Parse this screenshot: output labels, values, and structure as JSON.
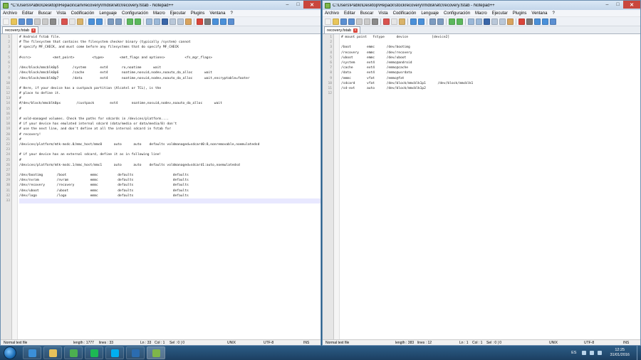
{
  "colors": {
    "close_button": "#c9463d",
    "current_line": "#e8e8ff",
    "taskbar": "#1c3f61"
  },
  "menu_items": [
    "Archivo",
    "Editar",
    "Buscar",
    "Vista",
    "Codificación",
    "Lenguaje",
    "Configuración",
    "Macro",
    "Ejecutar",
    "Plugins",
    "Ventana",
    "?"
  ],
  "left": {
    "title": "*C:\\Users\\Pablo\\Desktop\\Repack\\carlvrecovery\\rmdisk\\etc\\recovery.fstab - Notepad++",
    "tab": "recovery.fstab",
    "lines": [
      "# Android fstab file.",
      "# The filesystem that contains the filesystem checker binary (typically /system) cannot",
      "# specify MF_CHECK, and must come before any filesystems that do specify MF_CHECK",
      "",
      "#<src>           <mnt_point>         <type>        <mnt_flags and options>          <fs_mgr_flags>",
      "",
      "/dev/block/mmcblk0p5       /system       ext4       ro,noatime      wait",
      "/dev/block/mmcblk0p6       /cache        ext4       noatime,nosuid,nodev,noauto_da_alloc      wait",
      "/dev/block/mmcblk0p7       /data         ext4       noatime,nosuid,nodev,noauto_da_alloc      wait,encryptable=footer",
      "",
      "# Here, if your device has a custpack partition (Alcatel or TCL), is the",
      "# place to define it.",
      "#",
      "#/dev/block/mmcblk0px        /custpack        ext4       noatime,nosuid,nodev,noauto_da_alloc      wait",
      "#",
      "",
      "# vold-managed volumes. Check the paths for sdcards in /devices/platform....",
      "# if your device has emulated internal sdcard (data/media or data/media/0) don't",
      "# use the next line, and don't define at all the internal sdcard in fstab for",
      "# recovery!",
      "#",
      "/devices/platform/mtk-msdc.0/mmc_host/mmc0      auto      auto    defaults voldmanaged=sdcard0:8,nonremovable,noemulatedsd",
      "",
      "# if your device has an external sdcard, define it as in following line!",
      "#",
      "/devices/platform/mtk-msdc.1/mmc_host/mmc1      auto      auto    defaults voldmanaged=sdcard1:auto,noemulatedsd",
      "",
      "/dev/bootimg       /boot            emmc          defaults                    defaults",
      "/dev/nvram         /nvram           emmc          defaults                    defaults",
      "/dev/recovery      /recovery        emmc          defaults                    defaults",
      "/dev/uboot         /uboot           emmc          defaults                    defaults",
      "/dev/logo          /logo            emmc          defaults                    defaults",
      ""
    ],
    "status": {
      "type": "Normal text file",
      "length": "length : 1777",
      "lines": "lines : 33",
      "ln": "Ln : 33",
      "col": "Col : 1",
      "sel": "Sel : 0 | 0",
      "eol": "UNIX",
      "encoding": "UTF-8",
      "mode": "INS"
    }
  },
  "right": {
    "title": "C:\\Users\\Pablo\\Desktop\\Repack\\stockrecovery\\rmdisk\\etc\\recovery.fstab - Notepad++",
    "tab": "recovery.fstab",
    "lines": [
      "# mount point   fstype      device            [device2]",
      "",
      "/boot        emmc      /dev/bootimg",
      "/recovery    emmc      /dev/recovery",
      "/uboot       emmc      /dev/uboot",
      "/system      ext4      /emmc@android",
      "/cache       ext4      /emmc@cache",
      "/data        ext4      /emmc@usrdata",
      "/emmc        vfat      /emmc@fat",
      "/sdcard      vfat      /dev/block/mmcblk1p1      /dev/block/mmcblk1",
      "/sd-ext      auto      /dev/block/mmcblk1p2",
      ""
    ],
    "status": {
      "type": "Normal text file",
      "length": "length : 383",
      "lines": "lines : 12",
      "ln": "Ln : 1",
      "col": "Col : 1",
      "sel": "Sel : 0 | 0",
      "eol": "UNIX",
      "encoding": "UTF-8",
      "mode": "INS"
    }
  },
  "taskbar": {
    "apps": [
      {
        "name": "ie",
        "color": "#3b8fd8"
      },
      {
        "name": "explorer",
        "color": "#e7c15a"
      },
      {
        "name": "chrome",
        "color": "#4caf50"
      },
      {
        "name": "spotify",
        "color": "#1db954"
      },
      {
        "name": "skype",
        "color": "#00aff0"
      },
      {
        "name": "photoshop",
        "color": "#2b6cb0"
      },
      {
        "name": "notepadpp",
        "color": "#7fb64a"
      }
    ],
    "language": "ES",
    "time": "12:25",
    "date": "31/01/2016"
  }
}
